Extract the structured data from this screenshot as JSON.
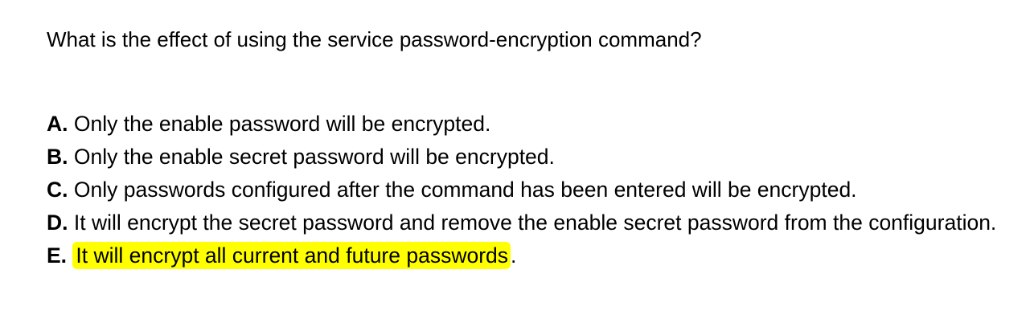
{
  "question": "What is the effect of using the service password-encryption command?",
  "options": [
    {
      "letter": "A.",
      "text": " Only the enable password will be encrypted."
    },
    {
      "letter": "B.",
      "text": " Only the enable secret password will be encrypted."
    },
    {
      "letter": "C.",
      "text": " Only passwords configured after the command has been entered will be encrypted."
    },
    {
      "letter": "D.",
      "text": " It will encrypt the secret password and remove the enable secret password from the configuration."
    },
    {
      "letter": "E.",
      "text": "It will encrypt all current and future passwords",
      "trailing": ".",
      "highlighted": true
    }
  ],
  "colors": {
    "highlight": "#ffff00",
    "text": "#000000"
  }
}
